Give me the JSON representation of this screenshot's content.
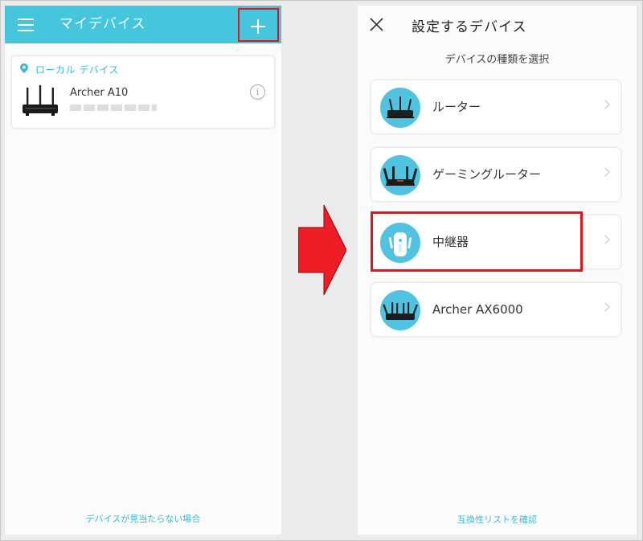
{
  "left": {
    "header_title": "マイデバイス",
    "section_label": "ローカル デバイス",
    "device_name": "Archer A10",
    "footer_link": "デバイスが見当たらない場合",
    "add_icon": "plus-icon",
    "menu_icon": "hamburger-icon",
    "info_icon": "info-icon"
  },
  "right": {
    "title": "設定するデバイス",
    "subtitle": "デバイスの種類を選択",
    "items": [
      {
        "label": "ルーター",
        "icon": "router-icon"
      },
      {
        "label": "ゲーミングルーター",
        "icon": "gaming-router-icon"
      },
      {
        "label": "中継器",
        "icon": "range-extender-icon"
      },
      {
        "label": "Archer AX6000",
        "icon": "router-icon"
      }
    ],
    "footer_link": "互換性リストを確認"
  },
  "colors": {
    "accent": "#45c6dd",
    "link": "#3db8cf",
    "highlight": "#e0161b",
    "arrow": "#ee1c24"
  }
}
